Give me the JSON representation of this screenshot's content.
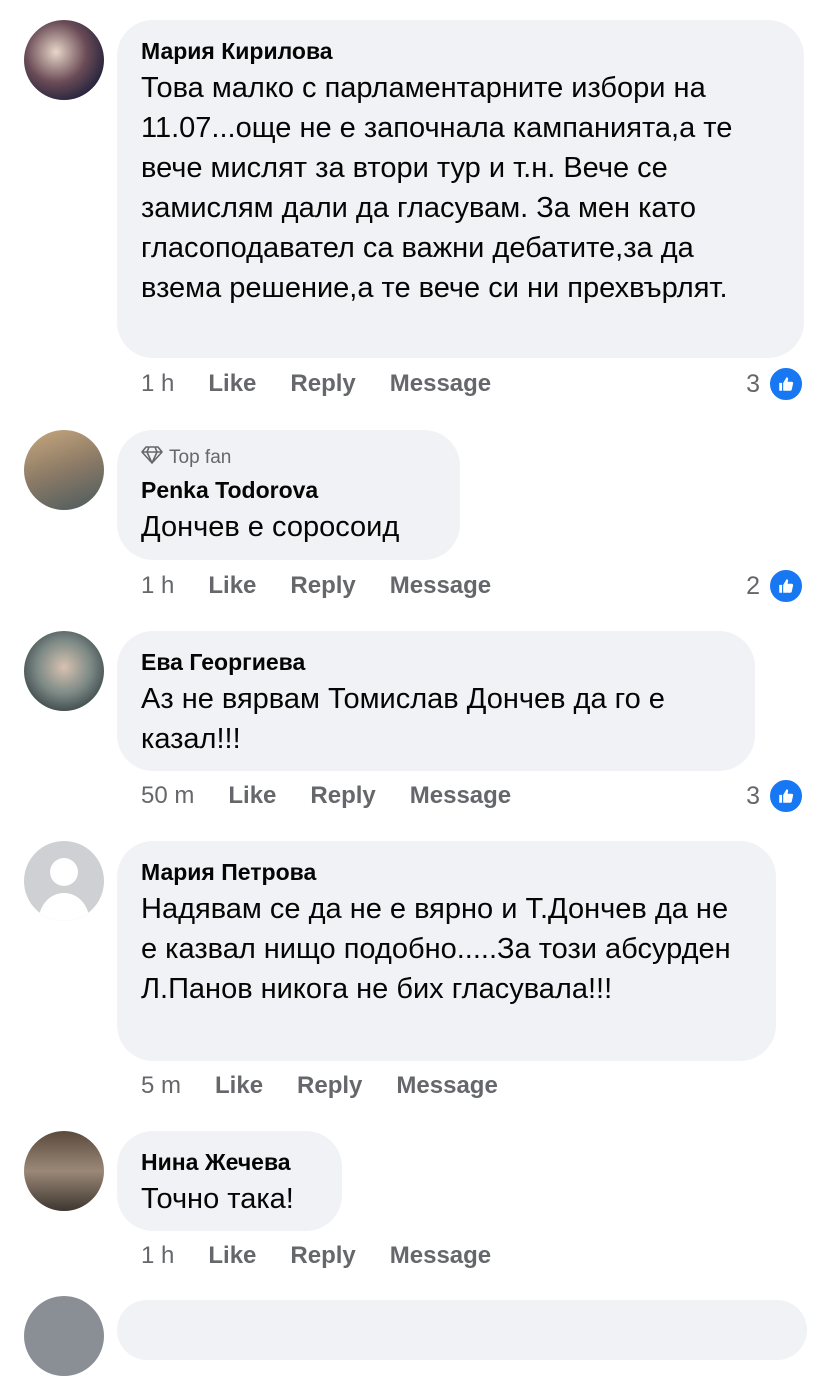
{
  "comments": [
    {
      "author": "Мария Кирилова",
      "top_fan": "",
      "text": "Това малко с парламентарните избори на 11.07...още не е започнала кампанията,а те вече мислят за втори тур и т.н. Вече се замислям дали да гласувам.  За мен като гласоподавател са важни дебатите,за да взема решение,а те вече си ни прехвърлят.",
      "time": "1 h",
      "like": "Like",
      "reply": "Reply",
      "message": "Message",
      "reactions": "3"
    },
    {
      "author": "Penka Todorova",
      "top_fan": "Top fan",
      "text": "Дончев е соросоид",
      "time": "1 h",
      "like": "Like",
      "reply": "Reply",
      "message": "Message",
      "reactions": "2"
    },
    {
      "author": "Ева Георгиева",
      "top_fan": "",
      "text": "Аз не вярвам Томислав Дончев да го е казал!!!",
      "time": "50 m",
      "like": "Like",
      "reply": "Reply",
      "message": "Message",
      "reactions": "3"
    },
    {
      "author": "Мария Петрова",
      "top_fan": "",
      "text": "Надявам се да не е вярно и Т.Дончев да не е казвал нищо подобно.....За този абсурден Л.Панов никога не бих гласувала!!!",
      "time": "5 m",
      "like": "Like",
      "reply": "Reply",
      "message": "Message",
      "reactions": ""
    },
    {
      "author": "Нина Жечева",
      "top_fan": "",
      "text": "Точно така!",
      "time": "1 h",
      "like": "Like",
      "reply": "Reply",
      "message": "Message",
      "reactions": ""
    }
  ],
  "colors": {
    "bubble": "#f0f2f5",
    "meta": "#65676b",
    "like_blue": "#1877f2"
  },
  "icons": {
    "top_fan": "diamond-icon",
    "reaction": "thumbs-up-icon"
  }
}
